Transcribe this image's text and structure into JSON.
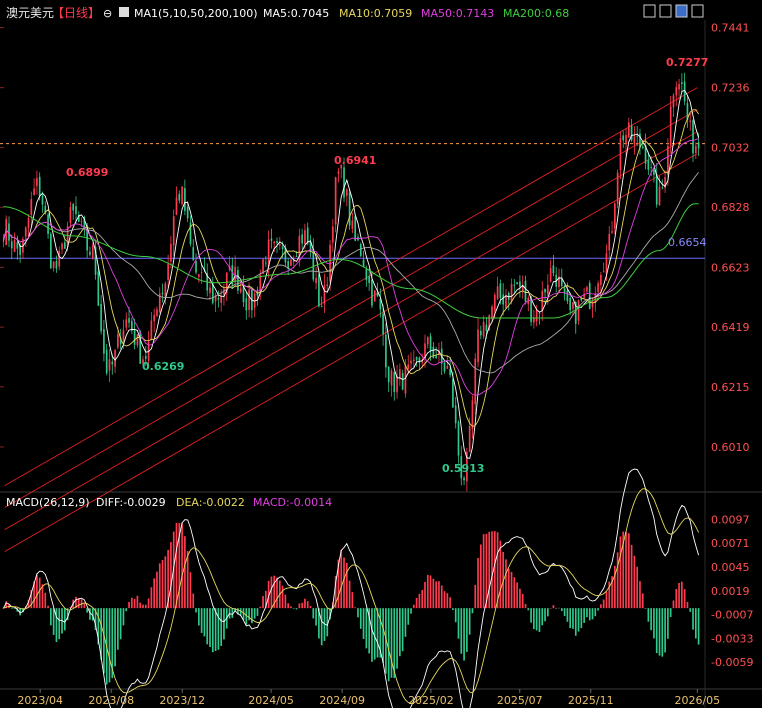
{
  "header": {
    "symbol": "澳元美元",
    "period": "【日线】",
    "ma_label": "MA1(5,10,50,200,100)",
    "ma5": "MA5:0.7045",
    "ma10": "MA10:0.7059",
    "ma50": "MA50:0.7143",
    "ma200": "MA200:0.68"
  },
  "macd_header": {
    "label": "MACD(26,12,9)",
    "diff": "DIFF:-0.0029",
    "dea": "DEA:-0.0022",
    "macd": "MACD:-0.0014"
  },
  "annotations": {
    "high1": "0.6899",
    "low1": "0.6269",
    "high2": "0.6941",
    "low2": "0.5913",
    "high3": "0.7277",
    "hline": "0.6654"
  },
  "colors": {
    "up": "#ff3b4f",
    "down": "#2fc98b",
    "ma5": "#ffffff",
    "ma10": "#e6d85c",
    "ma50": "#e040e0",
    "ma200": "#3ecf3e",
    "ma100": "#aaaaaa",
    "trend": "#e02020",
    "hline": "#6a6aff",
    "price_dash": "#ff9a4a",
    "axis_text": "#ff5050",
    "date_text": "#e8c070"
  },
  "chart_data": [
    {
      "type": "candlestick",
      "title": "澳元美元【日线】",
      "x_ticks": [
        "2023/04",
        "2023/08",
        "2023/12",
        "2024/05",
        "2024/09",
        "2025/02",
        "2025/07",
        "2025/11",
        "2026/05"
      ],
      "y_ticks": [
        "0.7441",
        "0.7236",
        "0.7032",
        "0.6828",
        "0.6623",
        "0.6419",
        "0.6215",
        "0.6010"
      ],
      "ylim": [
        0.587,
        0.746
      ],
      "current_price_line": 0.7045,
      "support_line": 0.6654,
      "anchors": [
        {
          "date": "2023/02",
          "price": 0.676
        },
        {
          "date": "2023/03",
          "price": 0.668
        },
        {
          "date": "2023/04",
          "price": 0.6899
        },
        {
          "date": "2023/05",
          "price": 0.662
        },
        {
          "date": "2023/06",
          "price": 0.68
        },
        {
          "date": "2023/07",
          "price": 0.668
        },
        {
          "date": "2023/08",
          "price": 0.6269
        },
        {
          "date": "2023/09",
          "price": 0.644
        },
        {
          "date": "2023/10",
          "price": 0.632
        },
        {
          "date": "2023/11",
          "price": 0.655
        },
        {
          "date": "2023/12",
          "price": 0.6875
        },
        {
          "date": "2024/01",
          "price": 0.66
        },
        {
          "date": "2024/02",
          "price": 0.652
        },
        {
          "date": "2024/03",
          "price": 0.66
        },
        {
          "date": "2024/04",
          "price": 0.65
        },
        {
          "date": "2024/05",
          "price": 0.668
        },
        {
          "date": "2024/06",
          "price": 0.666
        },
        {
          "date": "2024/07",
          "price": 0.673
        },
        {
          "date": "2024/08",
          "price": 0.65
        },
        {
          "date": "2024/09",
          "price": 0.6941
        },
        {
          "date": "2024/10",
          "price": 0.67
        },
        {
          "date": "2024/11",
          "price": 0.652
        },
        {
          "date": "2024/12",
          "price": 0.623
        },
        {
          "date": "2025/01",
          "price": 0.626
        },
        {
          "date": "2025/02",
          "price": 0.635
        },
        {
          "date": "2025/03",
          "price": 0.628
        },
        {
          "date": "2025/04",
          "price": 0.5913
        },
        {
          "date": "2025/05",
          "price": 0.642
        },
        {
          "date": "2025/06",
          "price": 0.652
        },
        {
          "date": "2025/07",
          "price": 0.656
        },
        {
          "date": "2025/08",
          "price": 0.647
        },
        {
          "date": "2025/09",
          "price": 0.661
        },
        {
          "date": "2025/10",
          "price": 0.646
        },
        {
          "date": "2025/11",
          "price": 0.652
        },
        {
          "date": "2025/12",
          "price": 0.666
        },
        {
          "date": "2026/01",
          "price": 0.708
        },
        {
          "date": "2026/02",
          "price": 0.704
        },
        {
          "date": "2026/03",
          "price": 0.686
        },
        {
          "date": "2026/04",
          "price": 0.7277
        },
        {
          "date": "2026/05",
          "price": 0.7045
        }
      ],
      "ma200_anchors": [
        {
          "date": "2023/02",
          "price": 0.683
        },
        {
          "date": "2023/06",
          "price": 0.673
        },
        {
          "date": "2023/10",
          "price": 0.666
        },
        {
          "date": "2024/02",
          "price": 0.657
        },
        {
          "date": "2024/06",
          "price": 0.66
        },
        {
          "date": "2024/09",
          "price": 0.665
        },
        {
          "date": "2025/01",
          "price": 0.655
        },
        {
          "date": "2025/05",
          "price": 0.645
        },
        {
          "date": "2025/09",
          "price": 0.645
        },
        {
          "date": "2025/12",
          "price": 0.652
        },
        {
          "date": "2026/03",
          "price": 0.668
        },
        {
          "date": "2026/05",
          "price": 0.684
        }
      ],
      "trend_channel": {
        "start": {
          "date": "2023/02",
          "price": 0.5878
        },
        "end": {
          "date": "2026/05",
          "price": 0.7236
        },
        "offsets": [
          0,
          -0.0075,
          -0.015,
          -0.0225
        ]
      }
    },
    {
      "type": "macd",
      "title": "MACD(26,12,9)",
      "y_ticks": [
        "0.0097",
        "0.0071",
        "0.0045",
        "0.0019",
        "-0.0007",
        "-0.0033",
        "-0.0059"
      ],
      "ylim": [
        -0.0085,
        0.0105
      ]
    }
  ]
}
